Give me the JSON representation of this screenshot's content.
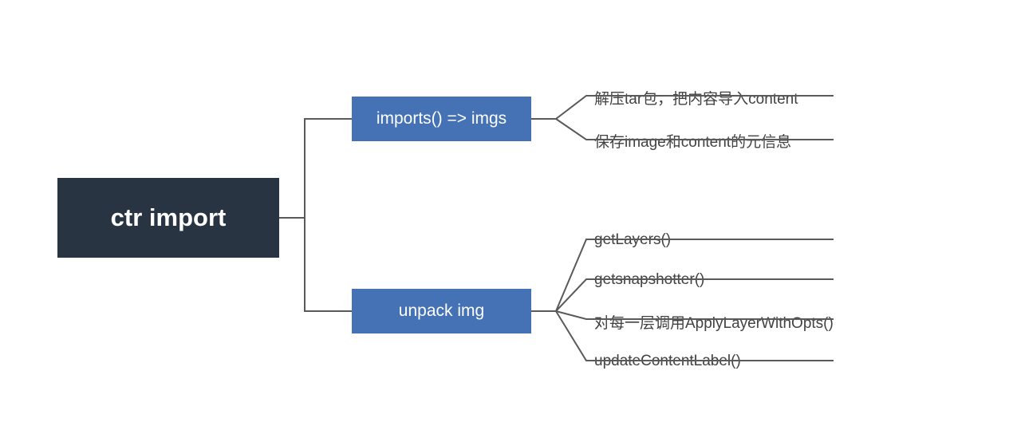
{
  "root": {
    "label": "ctr import"
  },
  "children": [
    {
      "label": "imports()  => imgs"
    },
    {
      "label": "unpack img"
    }
  ],
  "group1": [
    "解压tar包，把内容导入content",
    "保存image和content的元信息"
  ],
  "group2": [
    "getLayers()",
    "getsnapshotter()",
    "对每一层调用ApplyLayerWithOpts()",
    "updateContentLabel()"
  ],
  "colors": {
    "root_bg": "#283442",
    "child_bg": "#4472b5",
    "connector": "#5a5a5a"
  }
}
